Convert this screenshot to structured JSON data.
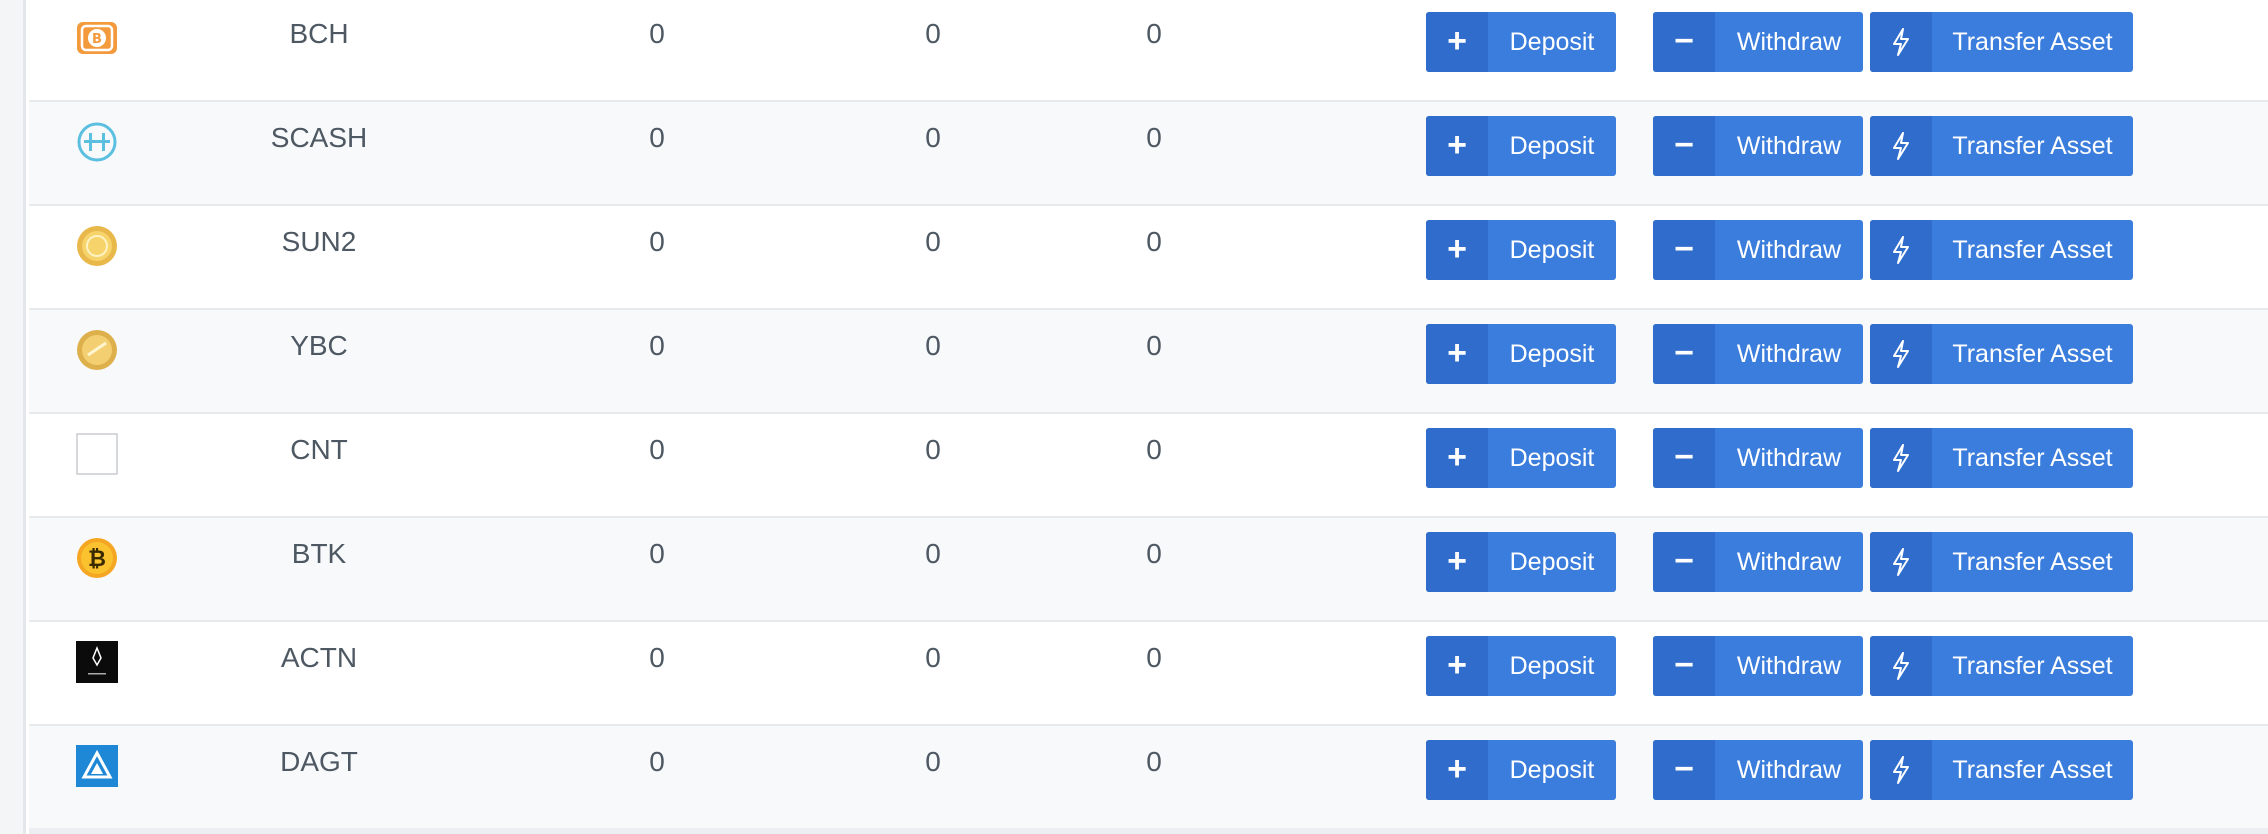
{
  "actions": {
    "deposit": "Deposit",
    "withdraw": "Withdraw",
    "transfer": "Transfer Asset"
  },
  "rows": [
    {
      "symbol": "BCH",
      "icon": "bch-icon",
      "v1": "0",
      "v2": "0",
      "v3": "0"
    },
    {
      "symbol": "SCASH",
      "icon": "scash-icon",
      "v1": "0",
      "v2": "0",
      "v3": "0"
    },
    {
      "symbol": "SUN2",
      "icon": "sun2-icon",
      "v1": "0",
      "v2": "0",
      "v3": "0"
    },
    {
      "symbol": "YBC",
      "icon": "ybc-icon",
      "v1": "0",
      "v2": "0",
      "v3": "0"
    },
    {
      "symbol": "CNT",
      "icon": "cnt-icon",
      "v1": "0",
      "v2": "0",
      "v3": "0"
    },
    {
      "symbol": "BTK",
      "icon": "btk-icon",
      "v1": "0",
      "v2": "0",
      "v3": "0"
    },
    {
      "symbol": "ACTN",
      "icon": "actn-icon",
      "v1": "0",
      "v2": "0",
      "v3": "0"
    },
    {
      "symbol": "DAGT",
      "icon": "dagt-icon",
      "v1": "0",
      "v2": "0",
      "v3": "0"
    }
  ],
  "colors": {
    "button": "#3b7ddd",
    "button_icon_bg": "#2f6ccb",
    "text": "#4d5863",
    "row_alt": "#f8f9fb"
  }
}
